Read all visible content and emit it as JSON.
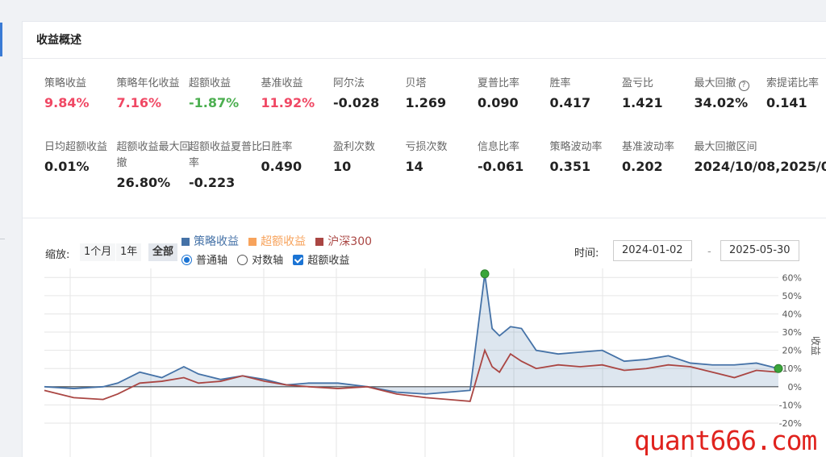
{
  "section": {
    "title": "收益概述"
  },
  "metrics_row1": [
    {
      "label": "策略收益",
      "value": "9.84%",
      "color": "red"
    },
    {
      "label": "策略年化收益",
      "value": "7.16%",
      "color": "red"
    },
    {
      "label": "超额收益",
      "value": "-1.87%",
      "color": "green"
    },
    {
      "label": "基准收益",
      "value": "11.92%",
      "color": "red"
    },
    {
      "label": "阿尔法",
      "value": "-0.028",
      "color": ""
    },
    {
      "label": "贝塔",
      "value": "1.269",
      "color": ""
    },
    {
      "label": "夏普比率",
      "value": "0.090",
      "color": ""
    },
    {
      "label": "胜率",
      "value": "0.417",
      "color": ""
    },
    {
      "label": "盈亏比",
      "value": "1.421",
      "color": ""
    },
    {
      "label": "最大回撤",
      "value": "34.02%",
      "color": "",
      "help_icon": "question-circle-icon"
    },
    {
      "label": "索提诺比率",
      "value": "0.141",
      "color": ""
    }
  ],
  "metrics_row2": [
    {
      "label": "日均超额收益",
      "value": "0.01%"
    },
    {
      "label": "超额收益最大回撤",
      "value": "26.80%"
    },
    {
      "label": "超额收益夏普比率",
      "value": "-0.223"
    },
    {
      "label": "日胜率",
      "value": "0.490"
    },
    {
      "label": "盈利次数",
      "value": "10"
    },
    {
      "label": "亏损次数",
      "value": "14"
    },
    {
      "label": "信息比率",
      "value": "-0.061"
    },
    {
      "label": "策略波动率",
      "value": "0.351"
    },
    {
      "label": "基准波动率",
      "value": "0.202"
    },
    {
      "label": "最大回撤区间",
      "value": "2024/10/08,2025/0"
    }
  ],
  "controls": {
    "zoom_label": "缩放:",
    "zoom_options": [
      "1个月",
      "1年",
      "全部"
    ],
    "zoom_selected": "全部",
    "legend": [
      {
        "name": "策略收益",
        "color": "#4572a7"
      },
      {
        "name": "超额收益",
        "color": "#f7a35c"
      },
      {
        "name": "沪深300",
        "color": "#aa4643"
      }
    ],
    "axis_options": [
      "普通轴",
      "对数轴"
    ],
    "axis_selected": "普通轴",
    "excess_checkbox_label": "超额收益",
    "excess_checked": true,
    "time_label": "时间:",
    "date_from": "2024-01-02",
    "date_separator": "-",
    "date_to": "2025-05-30"
  },
  "chart_data": {
    "type": "line",
    "ylabel": "收益",
    "y_ticks": [
      "60%",
      "50%",
      "40%",
      "30%",
      "20%",
      "10%",
      "0%",
      "-10%",
      "-20%"
    ],
    "ylim": [
      -20,
      65
    ],
    "x_range": [
      "2024-01-02",
      "2025-05-30"
    ],
    "series": [
      {
        "name": "策略收益",
        "color": "#4572a7",
        "x": [
          0,
          0.04,
          0.08,
          0.1,
          0.13,
          0.16,
          0.19,
          0.21,
          0.24,
          0.27,
          0.3,
          0.33,
          0.36,
          0.4,
          0.44,
          0.48,
          0.52,
          0.55,
          0.58,
          0.6,
          0.61,
          0.62,
          0.635,
          0.65,
          0.67,
          0.7,
          0.73,
          0.76,
          0.79,
          0.82,
          0.85,
          0.88,
          0.91,
          0.94,
          0.97,
          1.0
        ],
        "y": [
          0,
          -1,
          0,
          2,
          8,
          5,
          11,
          7,
          4,
          6,
          4,
          1,
          2,
          2,
          0,
          -3,
          -4,
          -3,
          -2,
          62,
          32,
          28,
          33,
          32,
          20,
          18,
          19,
          20,
          14,
          15,
          17,
          13,
          12,
          12,
          13,
          10
        ]
      },
      {
        "name": "沪深300",
        "color": "#aa4643",
        "x": [
          0,
          0.04,
          0.08,
          0.1,
          0.13,
          0.16,
          0.19,
          0.21,
          0.24,
          0.27,
          0.3,
          0.33,
          0.36,
          0.4,
          0.44,
          0.48,
          0.52,
          0.55,
          0.58,
          0.6,
          0.61,
          0.62,
          0.635,
          0.65,
          0.67,
          0.7,
          0.73,
          0.76,
          0.79,
          0.82,
          0.85,
          0.88,
          0.91,
          0.94,
          0.97,
          1.0
        ],
        "y": [
          -2,
          -6,
          -7,
          -4,
          2,
          3,
          5,
          2,
          3,
          6,
          3,
          1,
          0,
          -1,
          0,
          -4,
          -6,
          -7,
          -8,
          20,
          11,
          8,
          18,
          14,
          10,
          12,
          11,
          12,
          9,
          10,
          12,
          11,
          8,
          5,
          9,
          8
        ]
      }
    ],
    "markers": [
      {
        "series": "策略收益",
        "x": 0.6,
        "y": 62,
        "color": "#3aa53a"
      },
      {
        "series": "策略收益",
        "x": 1.0,
        "y": 10,
        "color": "#3aa53a"
      }
    ],
    "grid": true
  },
  "watermark": "quant666.com"
}
